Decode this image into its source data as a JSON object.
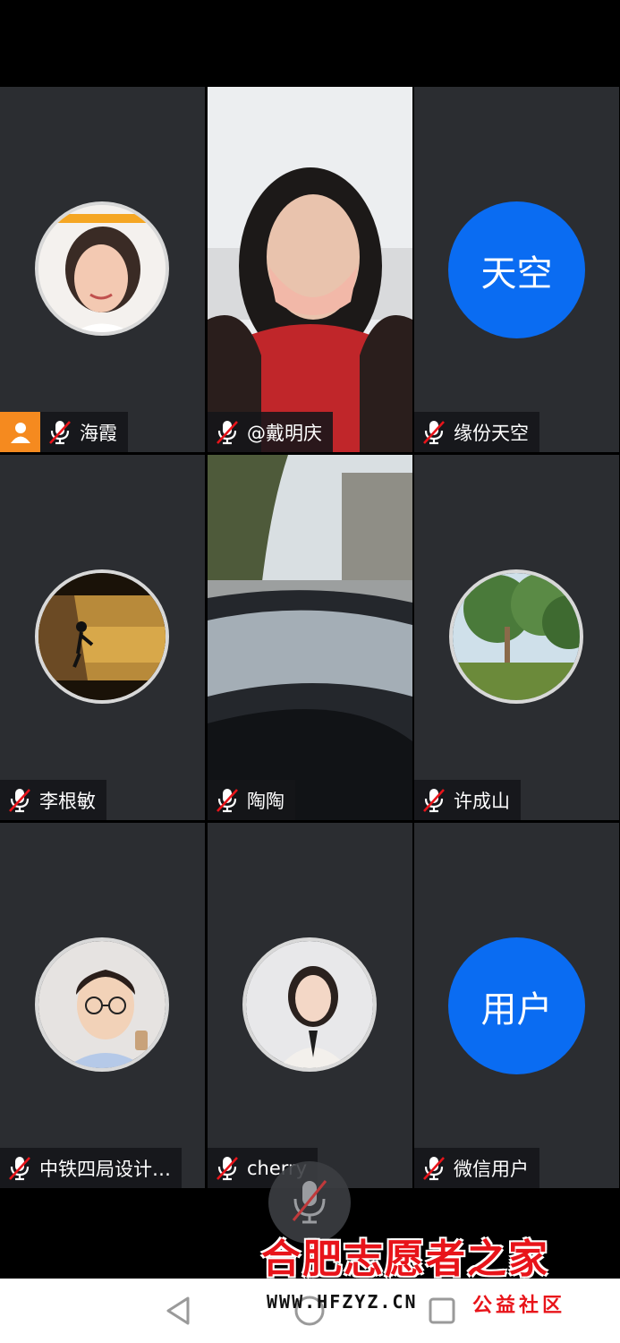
{
  "participants": [
    {
      "name": "海霞",
      "avatar": "photo-woman"
    },
    {
      "name": "@戴明庆",
      "avatar": "video"
    },
    {
      "name": "缘份天空",
      "avatar_text": "天空"
    },
    {
      "name": "李根敏",
      "avatar": "photo-climber"
    },
    {
      "name": "陶陶",
      "avatar": "video"
    },
    {
      "name": "许成山",
      "avatar": "photo-trees"
    },
    {
      "name": "中铁四局设计…",
      "avatar": "cartoon-man"
    },
    {
      "name": "cherry",
      "avatar": "photo-woman-suit"
    },
    {
      "name": "微信用户",
      "avatar_text": "用户"
    }
  ],
  "watermark": {
    "main": "合肥志愿者之家",
    "url": "WWW.HFZYZ.CN",
    "tag": "公益社区"
  },
  "colors": {
    "avatar_blue": "#0a6cf2",
    "host_orange": "#f58a1f",
    "muted_red": "#e8141a",
    "tile_bg": "#2b2d31"
  }
}
